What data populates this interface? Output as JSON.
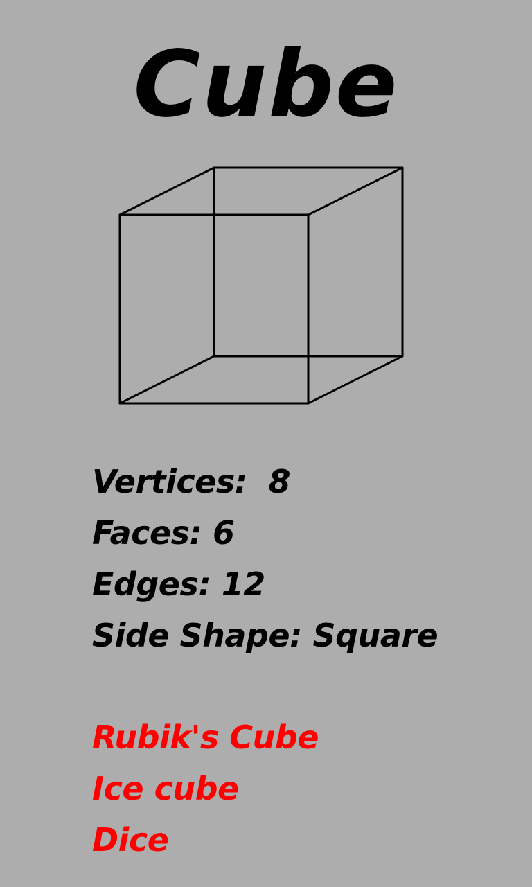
{
  "title": "Cube",
  "illustration": {
    "icon": "cube-wireframe-icon",
    "stroke_color": "#000000"
  },
  "properties": [
    {
      "text": "Vertices:  8"
    },
    {
      "text": "Faces: 6"
    },
    {
      "text": "Edges: 12"
    },
    {
      "text": "Side Shape: Square"
    }
  ],
  "examples": [
    {
      "text": "Rubik's Cube"
    },
    {
      "text": "Ice cube"
    },
    {
      "text": "Dice"
    }
  ],
  "colors": {
    "background": "#adadad",
    "text": "#000000",
    "example_text": "#ff0000"
  }
}
